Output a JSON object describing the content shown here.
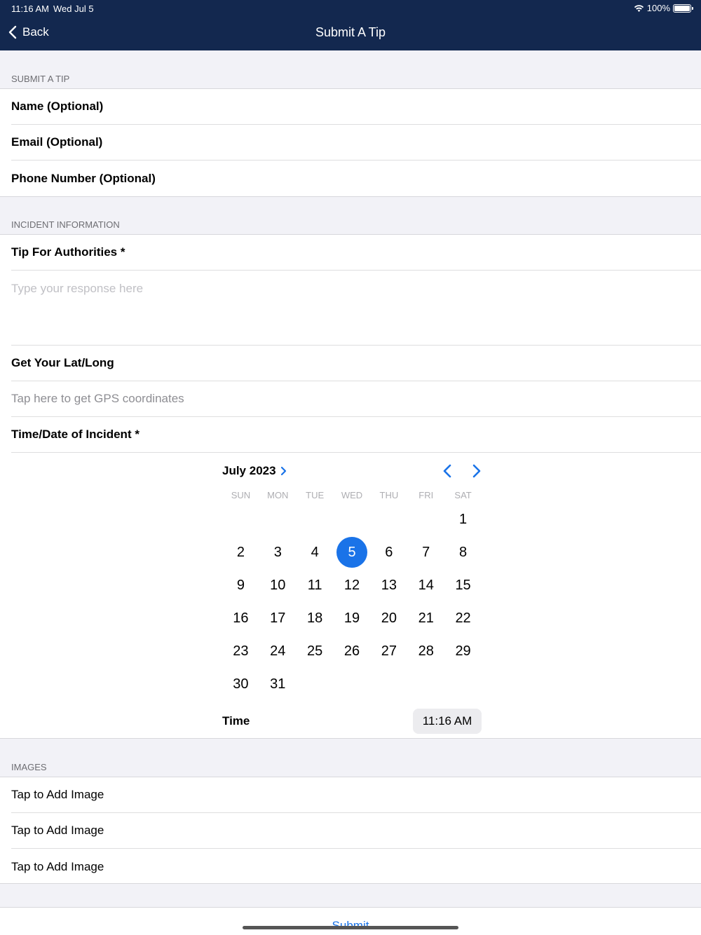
{
  "status": {
    "time": "11:16 AM",
    "date": "Wed Jul 5",
    "battery": "100%"
  },
  "nav": {
    "back_label": "Back",
    "title": "Submit A Tip"
  },
  "submit_section": {
    "header": "SUBMIT A TIP",
    "fields": [
      "Name (Optional)",
      "Email (Optional)",
      "Phone Number (Optional)"
    ]
  },
  "incident_section": {
    "header": "INCIDENT INFORMATION",
    "tip_label": "Tip For Authorities *",
    "tip_placeholder": "Type your response here",
    "latlong_label": "Get Your Lat/Long",
    "gps_action": "Tap here to get GPS coordinates",
    "datetime_label": "Time/Date of Incident *"
  },
  "calendar": {
    "month_label": "July 2023",
    "weekdays": [
      "SUN",
      "MON",
      "TUE",
      "WED",
      "THU",
      "FRI",
      "SAT"
    ],
    "first_weekday_index": 6,
    "days_in_month": 31,
    "selected_day": 5,
    "time_label": "Time",
    "time_value": "11:16 AM"
  },
  "images_section": {
    "header": "IMAGES",
    "items": [
      "Tap to Add Image",
      "Tap to Add Image",
      "Tap to Add Image"
    ]
  },
  "submit_label": "Submit",
  "colors": {
    "navbar": "#13284f",
    "accent": "#1a73e8",
    "background": "#f2f2f7"
  }
}
